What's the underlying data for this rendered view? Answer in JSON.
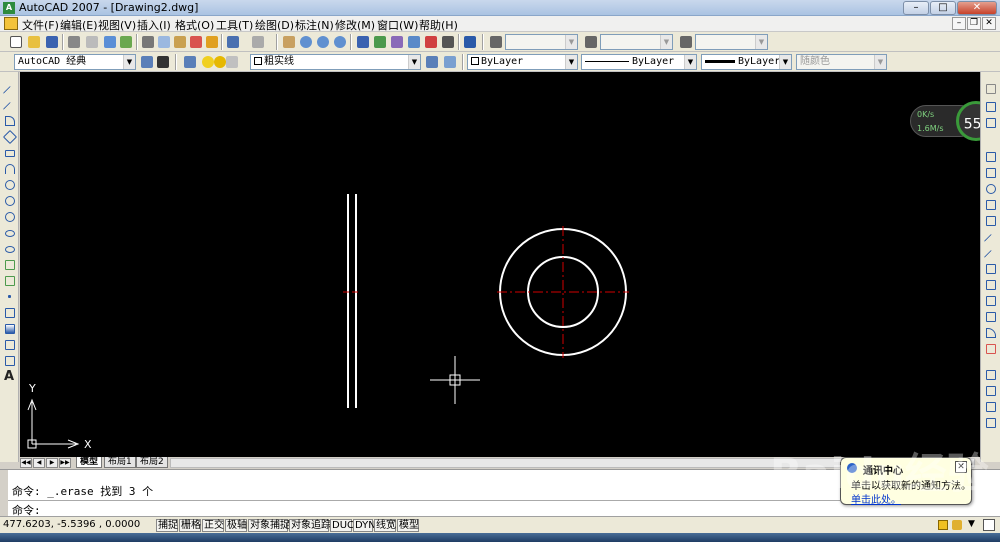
{
  "window": {
    "title": "AutoCAD 2007 - [Drawing2.dwg]",
    "min": "–",
    "max": "□",
    "close": "✕"
  },
  "menu": [
    "文件(F)",
    "编辑(E)",
    "视图(V)",
    "插入(I)",
    "格式(O)",
    "工具(T)",
    "绘图(D)",
    "标注(N)",
    "修改(M)",
    "窗口(W)",
    "帮助(H)"
  ],
  "toolbar2": {
    "workspace": "AutoCAD 经典",
    "layer": "粗实线",
    "color": "ByLayer",
    "linetype": "ByLayer",
    "lineweight": "ByLayer",
    "plotstyle": "随颜色"
  },
  "canvas": {
    "ucs_y": "Y",
    "ucs_x": "X",
    "background": "#000000",
    "line_color": "#ffffff",
    "center_color": "#d00000"
  },
  "tabs": [
    "模型",
    "布局1",
    "布局2"
  ],
  "command": {
    "history": "命令: _.erase 找到 3 个",
    "prompt": "命令:"
  },
  "status": {
    "coords": "477.6203, -5.5396 , 0.0000",
    "buttons": [
      "捕捉",
      "栅格",
      "正交",
      "极轴",
      "对象捕捉",
      "对象追踪",
      "DUCS",
      "DYN",
      "线宽",
      "模型"
    ]
  },
  "balloon": {
    "title": "通讯中心",
    "body": "单击以获取新的通知方法。",
    "link": "单击此处。",
    "close": "✕"
  },
  "netwidget": {
    "upload": "0K/s",
    "download": "1.6M/s",
    "percent": "55",
    "percent_unit": "%"
  },
  "watermark": "Baidu经验"
}
